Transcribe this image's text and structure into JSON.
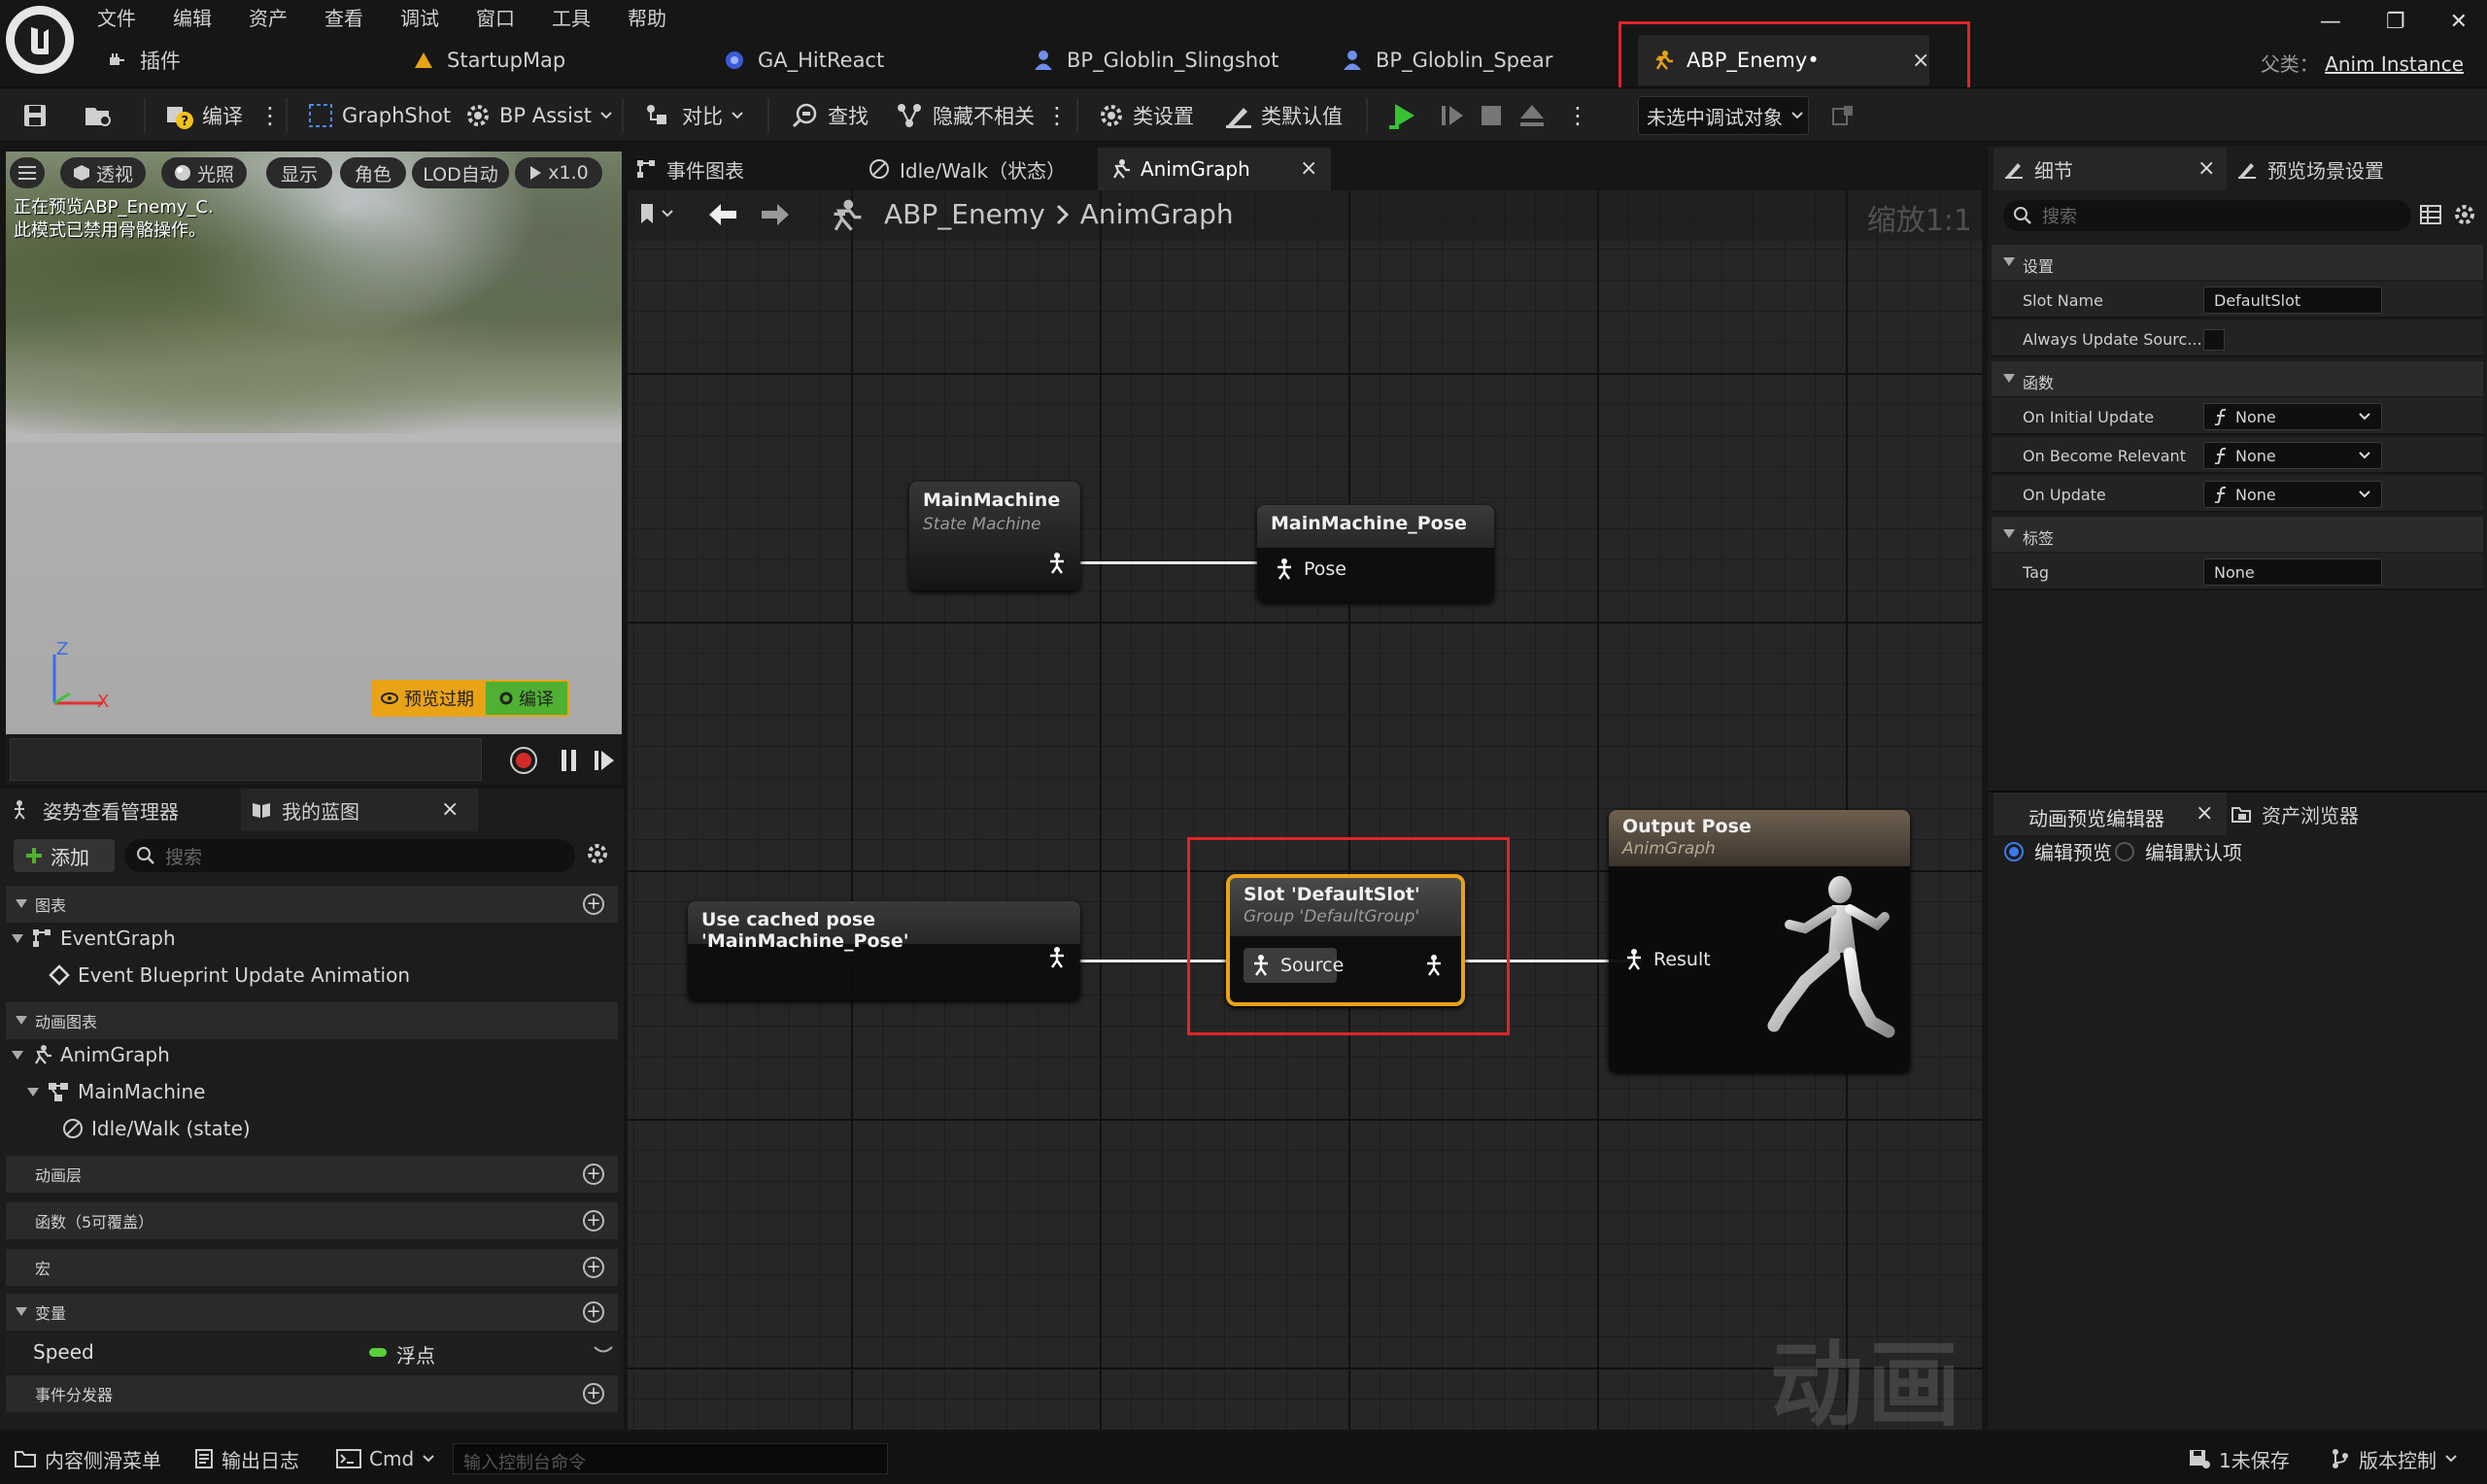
{
  "menu": [
    "文件",
    "编辑",
    "资产",
    "查看",
    "调试",
    "窗口",
    "工具",
    "帮助"
  ],
  "doc_tabs": {
    "plugins": "插件",
    "startup_map": "StartupMap",
    "ga_hitreact": "GA_HitReact",
    "bp_slingshot": "BP_Globlin_Slingshot",
    "bp_spear": "BP_Globlin_Spear",
    "active": "ABP_Enemy•",
    "close": "×"
  },
  "parent_class": {
    "label": "父类：",
    "value": "Anim Instance"
  },
  "window_controls": [
    "—",
    "❐",
    "✕"
  ],
  "toolbar": {
    "compile": "编译",
    "graphshot": "GraphShot",
    "bp_assist": "BP Assist",
    "diff": "对比",
    "find": "查找",
    "hide_unrelated": "隐藏不相关",
    "class_settings": "类设置",
    "class_defaults": "类默认值",
    "debug_target": "未选中调试对象"
  },
  "viewport": {
    "perspective": "透视",
    "lit": "光照",
    "show": "显示",
    "character": "角色",
    "lod": "LOD自动",
    "speed": "x1.0",
    "message_line1": "正在预览ABP_Enemy_C.",
    "message_line2": "此模式已禁用骨骼操作。",
    "axis_z": "Z",
    "axis_x": "X",
    "preview_stale": "预览过期",
    "compile_badge": "编译"
  },
  "left_panel": {
    "tab_pose_watch": "姿势查看管理器",
    "tab_my_blueprint": "我的蓝图",
    "add": "添加",
    "search_placeholder": "搜索",
    "section_graphs": "图表",
    "event_graph": "EventGraph",
    "event_update": "Event Blueprint Update Animation",
    "section_anim_graphs": "动画图表",
    "anim_graph": "AnimGraph",
    "main_machine": "MainMachine",
    "idle_walk": "Idle/Walk (state)",
    "section_anim_layers": "动画层",
    "section_functions": "函数（5可覆盖）",
    "section_macros": "宏",
    "section_variables": "变量",
    "var_speed": "Speed",
    "var_speed_type": "浮点",
    "section_dispatchers": "事件分发器"
  },
  "graph": {
    "tab_event_graph": "事件图表",
    "tab_idle_walk": "Idle/Walk（状态）",
    "tab_anim_graph": "AnimGraph",
    "breadcrumb_root": "ABP_Enemy",
    "breadcrumb_leaf": "AnimGraph",
    "zoom": "缩放1:1",
    "watermark": "动画",
    "nodes": {
      "main_machine_title": "MainMachine",
      "main_machine_sub": "State Machine",
      "mm_pose_title": "MainMachine_Pose",
      "mm_pose_pin": "Pose",
      "cached_title": "Use cached pose 'MainMachine_Pose'",
      "slot_title": "Slot 'DefaultSlot'",
      "slot_sub": "Group 'DefaultGroup'",
      "slot_pin": "Source",
      "output_title": "Output Pose",
      "output_sub": "AnimGraph",
      "output_pin": "Result"
    }
  },
  "details": {
    "tab_details": "细节",
    "tab_preview_scene": "预览场景设置",
    "search_placeholder": "搜索",
    "section_settings": "设置",
    "slot_name_label": "Slot Name",
    "slot_name_value": "DefaultSlot",
    "always_update_label": "Always Update Sourc...",
    "section_functions": "函数",
    "on_initial_update": "On Initial Update",
    "on_become_relevant": "On Become Relevant",
    "on_update": "On Update",
    "none": "None",
    "section_tags": "标签",
    "tag_label": "Tag",
    "tag_value": "None"
  },
  "preview_editor": {
    "tab_preview_editor": "动画预览编辑器",
    "tab_asset_browser": "资产浏览器",
    "edit_preview": "编辑预览",
    "edit_defaults": "编辑默认项"
  },
  "status_bar": {
    "content_drawer": "内容侧滑菜单",
    "output_log": "输出日志",
    "cmd": "Cmd",
    "console_placeholder": "输入控制台命令",
    "unsaved": "1未保存",
    "source_control": "版本控制"
  },
  "colors": {
    "highlight": "#e0242a",
    "selected_node": "#e8a317",
    "var_float": "#57d13a",
    "play_green": "#37c234"
  }
}
